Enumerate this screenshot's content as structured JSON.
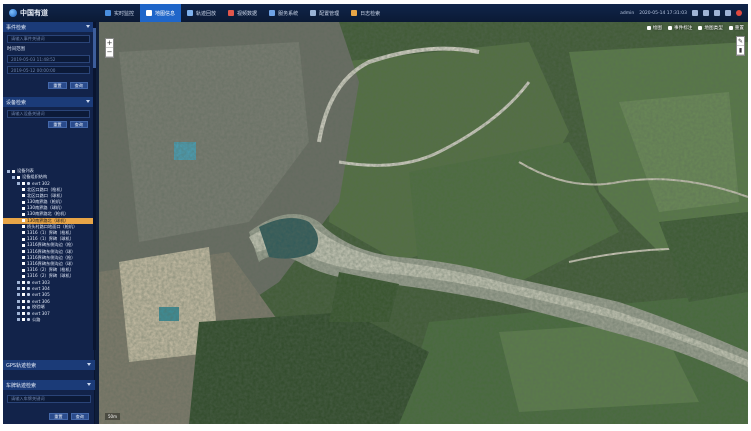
{
  "app": {
    "logo_text": "中国有道"
  },
  "nav": [
    {
      "label": "实时监控",
      "color": "#4a8fe0",
      "active": false
    },
    {
      "label": "地图信息",
      "color": "#ffffff",
      "active": true
    },
    {
      "label": "轨迹回放",
      "color": "#7fb2ee",
      "active": false
    },
    {
      "label": "视频数据",
      "color": "#e2574c",
      "active": false
    },
    {
      "label": "服务系统",
      "color": "#6fa3e6",
      "active": false
    },
    {
      "label": "配置管理",
      "color": "#9ab3d6",
      "active": false
    },
    {
      "label": "日志检索",
      "color": "#e8a547",
      "active": false
    }
  ],
  "topbar": {
    "user": "admin",
    "datetime": "2020-05-14  17:31:03"
  },
  "sidebar": {
    "event_panel": {
      "title": "事件检索",
      "search_placeholder": "请输入事件关键词",
      "time_label": "时间范围",
      "start_time": "2019-05-03 11:48:52",
      "end_time": "2019-05-12 00:00:00",
      "reset_label": "重置",
      "query_label": "查询"
    },
    "device_panel": {
      "title": "设备检索",
      "search_placeholder": "请输入设备关键词",
      "reset_label": "重置",
      "query_label": "查询"
    },
    "tree": [
      {
        "level": 0,
        "text": "设备列表",
        "sel": false
      },
      {
        "level": 1,
        "text": "设备组织结构",
        "sel": false
      },
      {
        "level": 2,
        "text": "evrt 302",
        "sel": false
      },
      {
        "level": 3,
        "text": "北区口路口（枪机）",
        "sel": false
      },
      {
        "level": 3,
        "text": "北区口路口（球机）",
        "sel": false
      },
      {
        "level": 3,
        "text": "130南界路（枪机）",
        "sel": false
      },
      {
        "level": 3,
        "text": "130南界路（球机）",
        "sel": false
      },
      {
        "level": 3,
        "text": "130南界路北（枪机）",
        "sel": false
      },
      {
        "level": 3,
        "text": "130南界路北（球机）",
        "sel": true
      },
      {
        "level": 3,
        "text": "桥头村路口地面口（枪机）",
        "sel": false
      },
      {
        "level": 3,
        "text": "1316（1）界碑（枪机）",
        "sel": false
      },
      {
        "level": 3,
        "text": "1316（1）界碑（球机）",
        "sel": false
      },
      {
        "level": 3,
        "text": "1316界碑东侧沟边（枪）",
        "sel": false
      },
      {
        "level": 3,
        "text": "1316界碑东侧沟边（球）",
        "sel": false
      },
      {
        "level": 3,
        "text": "1316界碑东侧沟边（枪）",
        "sel": false
      },
      {
        "level": 3,
        "text": "1316界碑东侧沟边（球）",
        "sel": false
      },
      {
        "level": 3,
        "text": "1316（2）界碑（枪机）",
        "sel": false
      },
      {
        "level": 3,
        "text": "1316（2）界碑（球机）",
        "sel": false
      },
      {
        "level": 2,
        "text": "evrt 303",
        "sel": false
      },
      {
        "level": 2,
        "text": "evrt 304",
        "sel": false
      },
      {
        "level": 2,
        "text": "evrt 305",
        "sel": false
      },
      {
        "level": 2,
        "text": "evrt 306",
        "sel": false
      },
      {
        "level": 2,
        "text": "校验端",
        "sel": false
      },
      {
        "level": 2,
        "text": "evrt 307",
        "sel": false
      },
      {
        "level": 2,
        "text": "公路",
        "sel": false
      }
    ],
    "gps_panel": {
      "title": "GPS轨迹检索"
    },
    "car_panel": {
      "title": "车牌轨迹检索",
      "search_placeholder": "请输入车牌关键词",
      "reset_label": "重置",
      "query_label": "查询"
    }
  },
  "map": {
    "tools": [
      {
        "label": "绘图"
      },
      {
        "label": "事件标注"
      },
      {
        "label": "地图类型"
      },
      {
        "label": "重置"
      }
    ],
    "zoom_in": "+",
    "zoom_out": "−",
    "scale_text": "50m"
  }
}
